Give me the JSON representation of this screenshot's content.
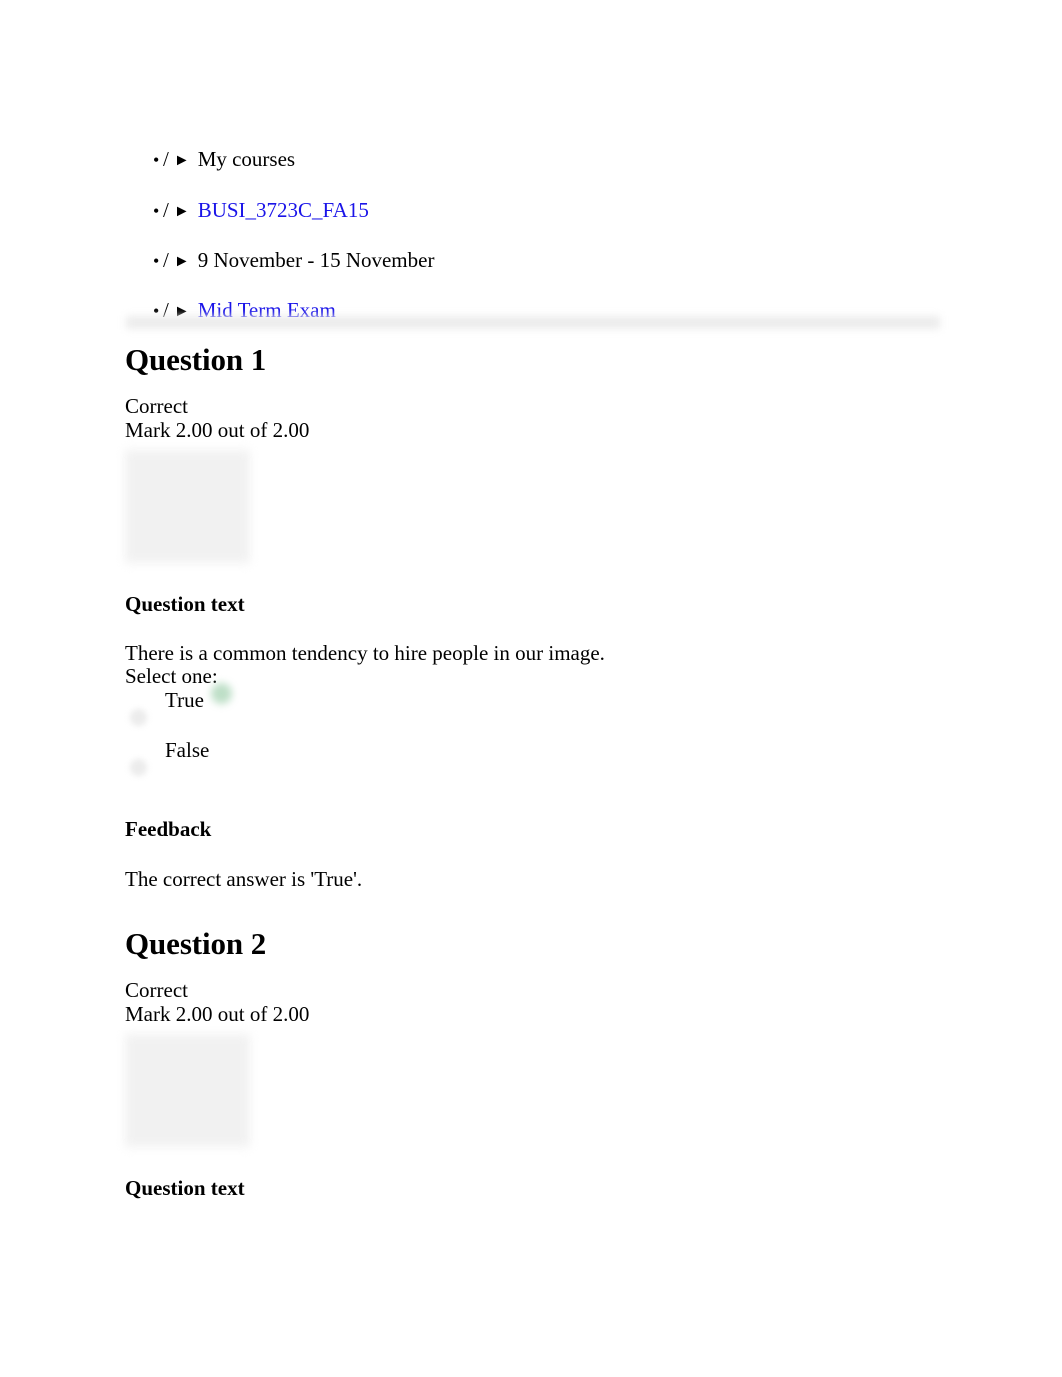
{
  "breadcrumb": {
    "separator": "/",
    "arrow": "►",
    "bullet": "•",
    "items": [
      {
        "label": "My courses",
        "is_link": false
      },
      {
        "label": "BUSI_3723C_FA15",
        "is_link": true
      },
      {
        "label": "9 November - 15 November",
        "is_link": false
      },
      {
        "label": "Mid Term Exam",
        "is_link": true
      }
    ]
  },
  "colors": {
    "link": "#1a14e8",
    "text": "#000000",
    "placeholder": "#f0f0f0",
    "correct_mark": "#b2d9bd",
    "divider": "#ebebeb"
  },
  "questions": [
    {
      "heading": "Question 1",
      "state": "Correct",
      "mark": "Mark 2.00 out of 2.00",
      "question_text_heading": "Question text",
      "stem": "There is a common tendency to hire people in our image.",
      "select_prompt": "Select one:",
      "answers": [
        {
          "label": "True",
          "selected": true,
          "correct": true
        },
        {
          "label": "False",
          "selected": false,
          "correct": false
        }
      ],
      "feedback_heading": "Feedback",
      "feedback_text": "The correct answer is 'True'."
    },
    {
      "heading": "Question 2",
      "state": "Correct",
      "mark": "Mark 2.00 out of 2.00",
      "question_text_heading": "Question text"
    }
  ]
}
